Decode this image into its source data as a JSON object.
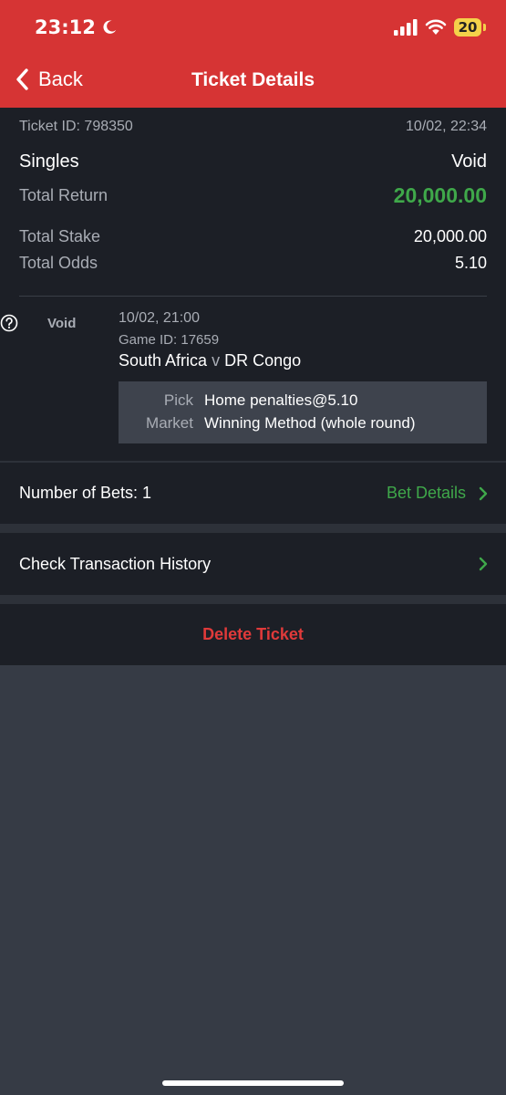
{
  "status_bar": {
    "time": "23:12",
    "battery": "20"
  },
  "nav": {
    "back_label": "Back",
    "title": "Ticket Details"
  },
  "ticket": {
    "id_text": "Ticket ID: 798350",
    "datetime": "10/02, 22:34",
    "bet_type": "Singles",
    "status": "Void",
    "total_return_label": "Total Return",
    "total_return_value": "20,000.00",
    "total_stake_label": "Total Stake",
    "total_stake_value": "20,000.00",
    "total_odds_label": "Total Odds",
    "total_odds_value": "5.10"
  },
  "bet": {
    "status": "Void",
    "datetime": "10/02, 21:00",
    "game_id": "Game ID: 17659",
    "home_team": "South Africa",
    "vs": "v",
    "away_team": "DR Congo",
    "pick_label": "Pick",
    "pick_value": "Home penalties@5.10",
    "market_label": "Market",
    "market_value": "Winning Method (whole round)"
  },
  "bets_panel": {
    "count_label": "Number of Bets: 1",
    "details_link": "Bet Details"
  },
  "history_panel": {
    "label": "Check Transaction History"
  },
  "delete_panel": {
    "label": "Delete Ticket"
  },
  "colors": {
    "header": "#d63434",
    "accent_green": "#3fa84a",
    "delete_red": "#e03a3a",
    "background": "#363b45",
    "panel": "#1c1f26"
  }
}
